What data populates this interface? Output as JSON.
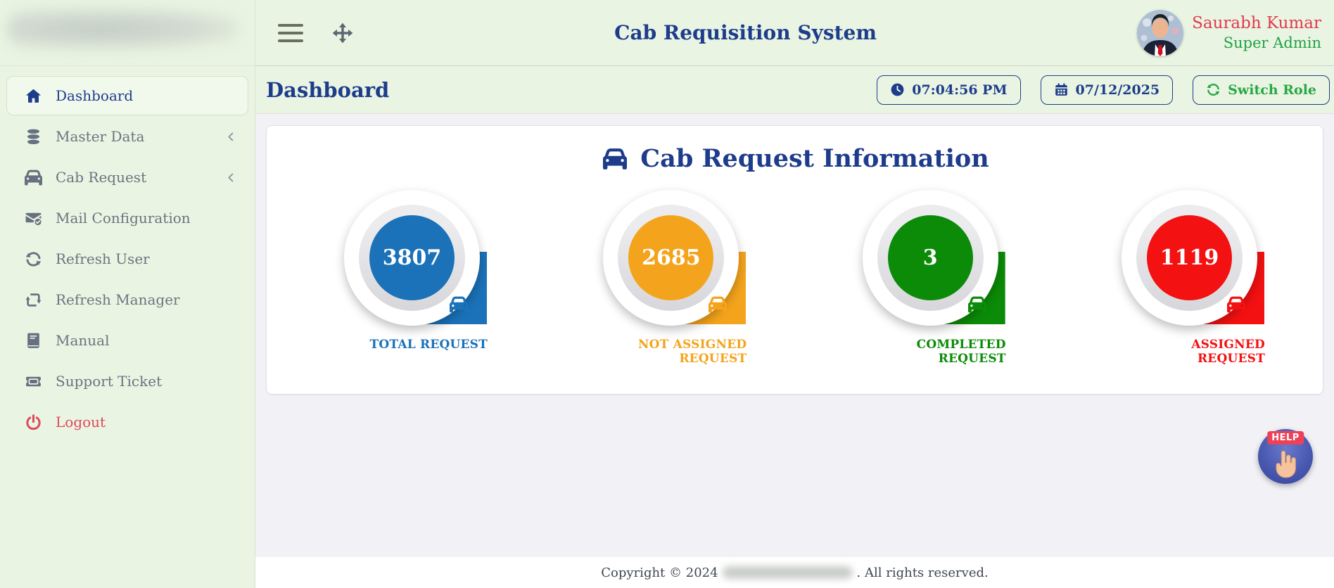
{
  "app": {
    "title": "Cab Requisition System"
  },
  "topbar": {
    "menu_icon": "hamburger-icon",
    "fullscreen_icon": "expand-arrows-icon",
    "user": {
      "name": "Saurabh Kumar",
      "role": "Super Admin",
      "avatar_icon": "user-avatar"
    }
  },
  "page_header": {
    "title": "Dashboard",
    "time": "07:04:56 PM",
    "time_icon": "clock-icon",
    "date": "07/12/2025",
    "date_icon": "calendar-icon",
    "switch_role": "Switch Role",
    "switch_role_icon": "sync-icon"
  },
  "sidebar": {
    "items": [
      {
        "label": "Dashboard",
        "icon": "home-icon",
        "active": true
      },
      {
        "label": "Master Data",
        "icon": "database-icon",
        "has_submenu": true
      },
      {
        "label": "Cab Request",
        "icon": "car-icon",
        "has_submenu": true
      },
      {
        "label": "Mail Configuration",
        "icon": "mail-check-icon"
      },
      {
        "label": "Refresh User",
        "icon": "refresh-icon"
      },
      {
        "label": "Refresh Manager",
        "icon": "refresh-square-icon"
      },
      {
        "label": "Manual",
        "icon": "book-icon"
      },
      {
        "label": "Support Ticket",
        "icon": "ticket-icon"
      },
      {
        "label": "Logout",
        "icon": "power-icon",
        "danger": true
      }
    ]
  },
  "main": {
    "card_title": "Cab Request Information",
    "card_title_icon": "car-icon",
    "widgets": [
      {
        "value": "3807",
        "label": "TOTAL REQUEST",
        "color": "#1b72b8",
        "icon": "car-icon"
      },
      {
        "value": "2685",
        "label": "NOT ASSIGNED REQUEST",
        "color": "#f4a41c",
        "icon": "car-icon"
      },
      {
        "value": "3",
        "label": "COMPLETED REQUEST",
        "color": "#0b8b07",
        "icon": "car-icon"
      },
      {
        "value": "1119",
        "label": "ASSIGNED REQUEST",
        "color": "#f31111",
        "icon": "car-icon"
      }
    ]
  },
  "help": {
    "label": "HELP",
    "icon": "hand-pointer-icon"
  },
  "footer": {
    "prefix": "Copyright © 2024",
    "suffix": ". All rights reserved."
  },
  "colors": {
    "navy": "#1e3c8c",
    "sidebar_bg": "#e9f5e2",
    "content_bg": "#f1f1f6",
    "name_red": "#e4384e",
    "role_green": "#22a147",
    "switch_green": "#28a745",
    "logout_red": "#e0485c"
  }
}
